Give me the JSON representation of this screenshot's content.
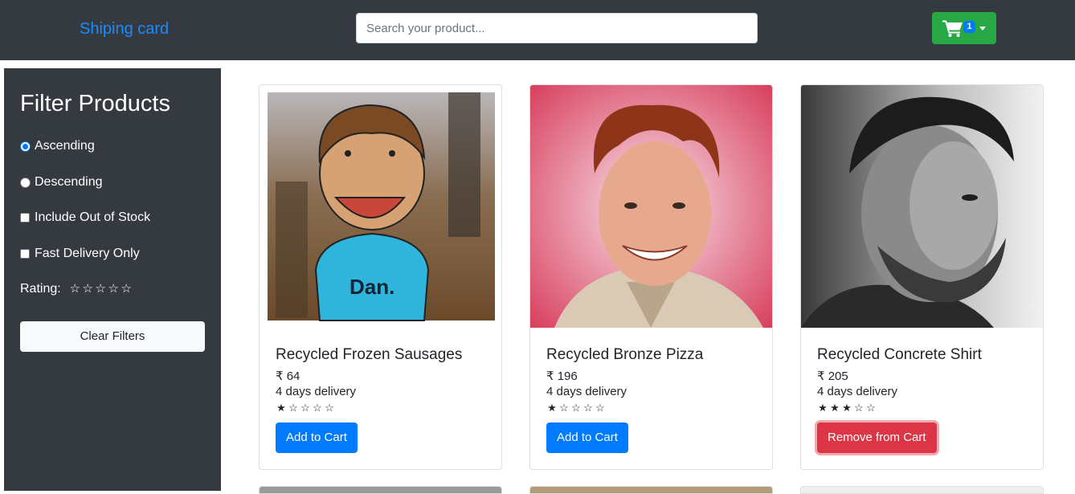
{
  "header": {
    "brand": "Shiping card",
    "search_placeholder": "Search your product...",
    "cart_icon": "shopping-cart-icon",
    "cart_count": "1",
    "caret_icon": "chevron-down-icon"
  },
  "sidebar": {
    "title": "Filter Products",
    "ascending_label": "Ascending",
    "descending_label": "Descending",
    "out_of_stock_label": "Include Out of Stock",
    "fast_delivery_label": "Fast Delivery Only",
    "rating_label": "Rating:",
    "rating_value": 0,
    "rating_max": 5,
    "clear_label": "Clear Filters",
    "sort_selected": "ascending",
    "out_of_stock_checked": false,
    "fast_delivery_checked": false
  },
  "products": [
    {
      "image": "cartoon-boy-avatar",
      "name": "Recycled Frozen Sausages",
      "price": "₹ 64",
      "delivery": "4 days delivery",
      "rating": 1,
      "rating_max": 5,
      "button": "Add to Cart",
      "in_cart": false
    },
    {
      "image": "smiling-man-photo",
      "name": "Recycled Bronze Pizza",
      "price": "₹ 196",
      "delivery": "4 days delivery",
      "rating": 1,
      "rating_max": 5,
      "button": "Add to Cart",
      "in_cart": false
    },
    {
      "image": "bearded-man-bw-photo",
      "name": "Recycled Concrete Shirt",
      "price": "₹ 205",
      "delivery": "4 days delivery",
      "rating": 3,
      "rating_max": 5,
      "button": "Remove from Cart",
      "in_cart": true
    }
  ],
  "colors": {
    "navbar": "#343a40",
    "brand": "#1a8cff",
    "cart": "#28a745",
    "primary": "#007bff",
    "danger": "#dc3545"
  }
}
